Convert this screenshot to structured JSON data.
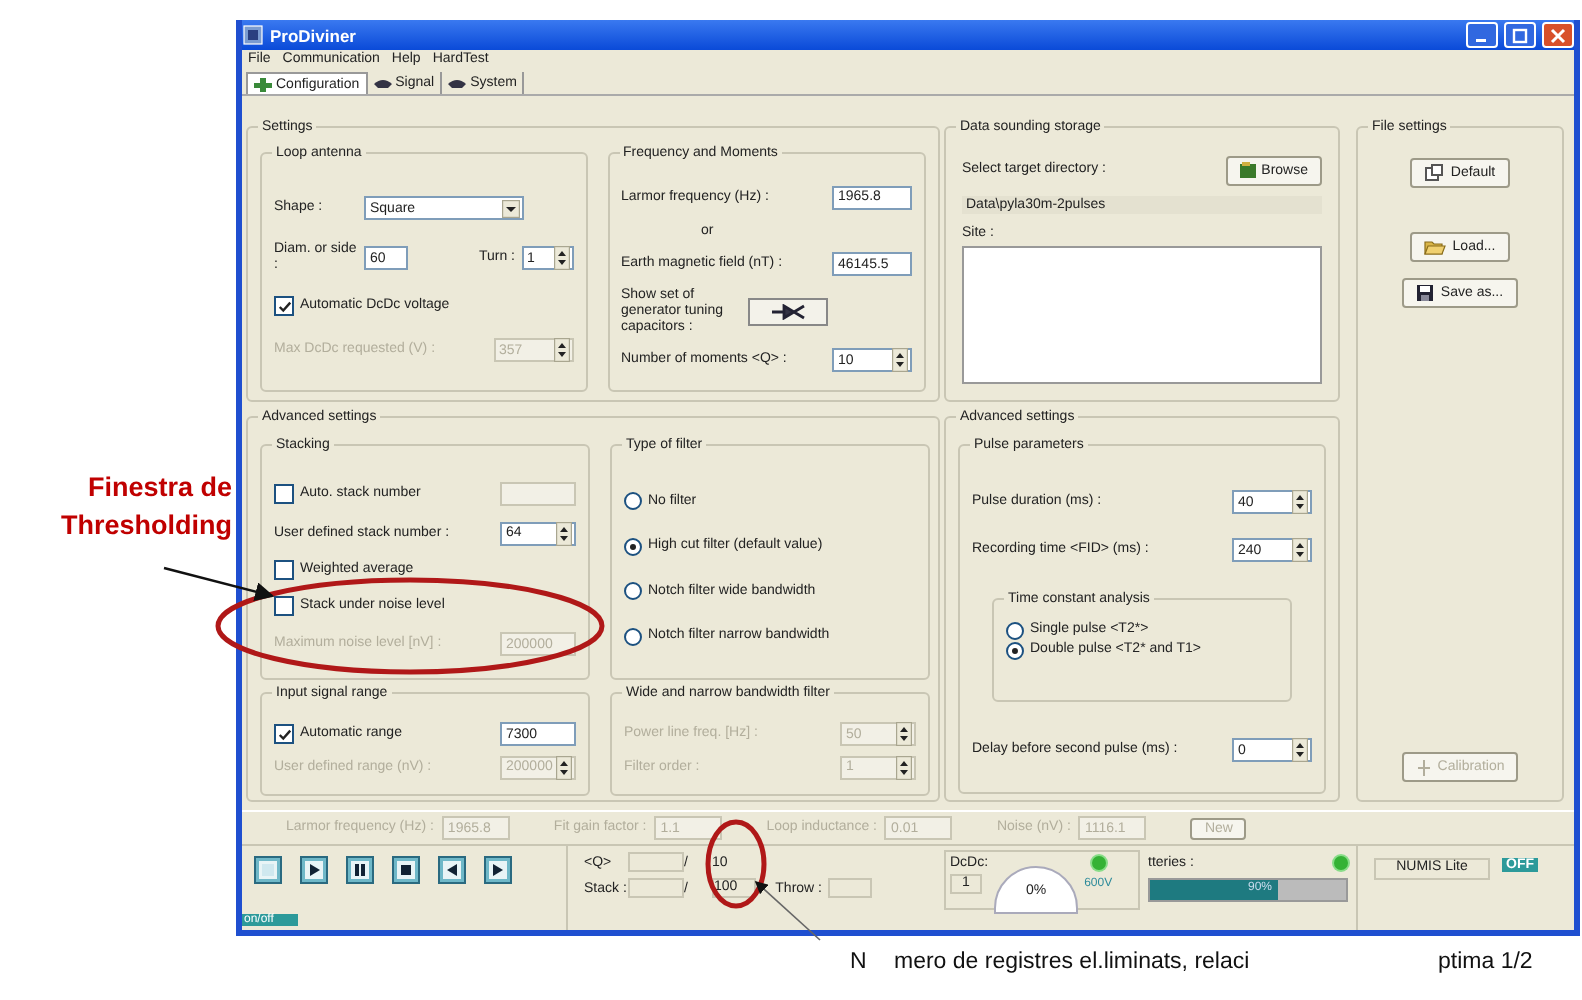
{
  "window": {
    "title": "ProDiviner"
  },
  "menu": [
    {
      "label": "File"
    },
    {
      "label": "Communication"
    },
    {
      "label": "Help"
    },
    {
      "label": "HardTest"
    }
  ],
  "tabs": [
    {
      "label": "Configuration",
      "selected": true
    },
    {
      "label": "Signal",
      "selected": false
    },
    {
      "label": "System",
      "selected": false
    }
  ],
  "settings": {
    "title": "Settings",
    "groups": [
      {
        "title": "Loop antenna",
        "rows": [
          {
            "kind": "combo",
            "label": "Shape :",
            "value": "Square"
          },
          {
            "kind": "pair",
            "label": "Diam. or side :",
            "value": "60",
            "label_2": "Turn :",
            "value_2": "1"
          },
          {
            "kind": "check",
            "label": "Automatic DcDc voltage",
            "checked": true
          },
          {
            "kind": "spin",
            "label": "Max DcDc requested (V) :",
            "value": "357",
            "disabled": true
          }
        ]
      },
      {
        "title": "Frequency and Moments",
        "rows": [
          {
            "kind": "field",
            "label": "Larmor frequency (Hz) :",
            "value": "1965.8",
            "disabled": false
          },
          {
            "kind": "note",
            "label": "or"
          },
          {
            "kind": "field",
            "label": "Earth magnetic field (nT) :",
            "value": "46145.5",
            "disabled": false
          },
          {
            "kind": "tool",
            "label": "Show set of generator tuning capacitors :"
          },
          {
            "kind": "spin",
            "label": "Number of moments <Q> :",
            "value": "10",
            "disabled": false
          }
        ]
      }
    ]
  },
  "storage": {
    "title": "Data sounding storage",
    "directory_label": "Select target directory :",
    "browse": "Browse",
    "path": "Data\\pyla30m-2pulses",
    "site_label": "Site :"
  },
  "file_settings": {
    "title": "File settings",
    "buttons": [
      {
        "label": "Default"
      },
      {
        "label": "Load..."
      },
      {
        "label": "Save as..."
      }
    ],
    "calibration": {
      "label": "Calibration",
      "disabled": true
    }
  },
  "advanced_left": {
    "title": "Advanced settings",
    "groups": [
      {
        "title": "Stacking",
        "rows": [
          {
            "kind": "checkfield",
            "label": "Auto. stack number",
            "checked": false,
            "disabled": true
          },
          {
            "kind": "spin",
            "label": "User defined stack number :",
            "value": "64",
            "disabled": false
          },
          {
            "kind": "check",
            "label": "Weighted average",
            "checked": false
          },
          {
            "kind": "check",
            "label": "Stack under noise level",
            "checked": false
          },
          {
            "kind": "field",
            "label": "Maximum noise level [nV] :",
            "value": "200000",
            "disabled": true
          }
        ]
      },
      {
        "title": "Type of filter",
        "rows": [
          {
            "kind": "radio",
            "label": "No filter",
            "selected": false
          },
          {
            "kind": "radio",
            "label": "High cut filter (default value)",
            "selected": true
          },
          {
            "kind": "radio",
            "label": "Notch filter wide bandwidth",
            "selected": false
          },
          {
            "kind": "radio",
            "label": "Notch filter narrow bandwidth",
            "selected": false
          }
        ]
      },
      {
        "title": "Input signal range",
        "rows": [
          {
            "kind": "checkfield",
            "label": "Automatic range",
            "checked": true,
            "value": "7300",
            "disabled": false
          },
          {
            "kind": "spin",
            "label": "User defined range (nV) :",
            "value": "200000",
            "disabled": true
          }
        ]
      },
      {
        "title": "Wide and narrow bandwidth filter",
        "rows": [
          {
            "kind": "spin",
            "label": "Power line freq. [Hz] :",
            "value": "50",
            "disabled": true
          },
          {
            "kind": "spin",
            "label": "Filter order :",
            "value": "1",
            "disabled": true
          }
        ]
      }
    ]
  },
  "advanced_right": {
    "title": "Advanced settings",
    "groups": [
      {
        "title": "Pulse parameters",
        "rows": [
          {
            "kind": "spin",
            "label": "Pulse duration (ms) :",
            "value": "40",
            "disabled": false
          },
          {
            "kind": "spin",
            "label": "Recording time <FID> (ms) :",
            "value": "240",
            "disabled": false
          },
          {
            "kind": "subgroup",
            "title": "Time constant analysis",
            "rows": [
              {
                "kind": "radio",
                "label": "Single pulse <T2*>",
                "selected": false
              },
              {
                "kind": "radio",
                "label": "Double pulse <T2* and T1>",
                "selected": true
              }
            ]
          },
          {
            "kind": "spin",
            "label": "Delay before second pulse (ms) :",
            "value": "0",
            "disabled": false
          }
        ]
      }
    ]
  },
  "status_row": {
    "items": [
      {
        "label": "Larmor frequency (Hz) :",
        "value": "1965.8",
        "disabled": true
      },
      {
        "label": "Fit gain factor :",
        "value": "1.1",
        "disabled": true
      },
      {
        "label": "Loop inductance :",
        "value": "0.01",
        "disabled": true
      },
      {
        "label": "Noise (nV) :",
        "value": "1116.1",
        "disabled": true
      }
    ],
    "new_button": {
      "label": "New",
      "disabled": true
    }
  },
  "player": {
    "buttons": [
      {
        "kind": "blank"
      },
      {
        "kind": "play"
      },
      {
        "kind": "pause"
      },
      {
        "kind": "stop"
      },
      {
        "kind": "back"
      },
      {
        "kind": "forward"
      }
    ],
    "power": "on/off"
  },
  "counters": {
    "q_label": "<Q>",
    "q_separator": "/",
    "q_total": "10",
    "stack_label": "Stack :",
    "stack_separator": "/",
    "stack_total": "100",
    "throw_label": "Throw :"
  },
  "dcdc": {
    "label": "DcDc:",
    "value": "1",
    "gauge": "0%",
    "voltage": "600V",
    "led_on": true
  },
  "batteries": {
    "label": "tteries :",
    "led_on": true,
    "level": 0.65,
    "reading": "90%"
  },
  "numis": {
    "label": "NUMIS Lite",
    "state": "OFF"
  },
  "annotations": {
    "window_note": "Finestra de Thresholding",
    "footnote": [
      "N",
      "mero de registres el.liminats, relaci",
      "ptima 1/2"
    ]
  }
}
